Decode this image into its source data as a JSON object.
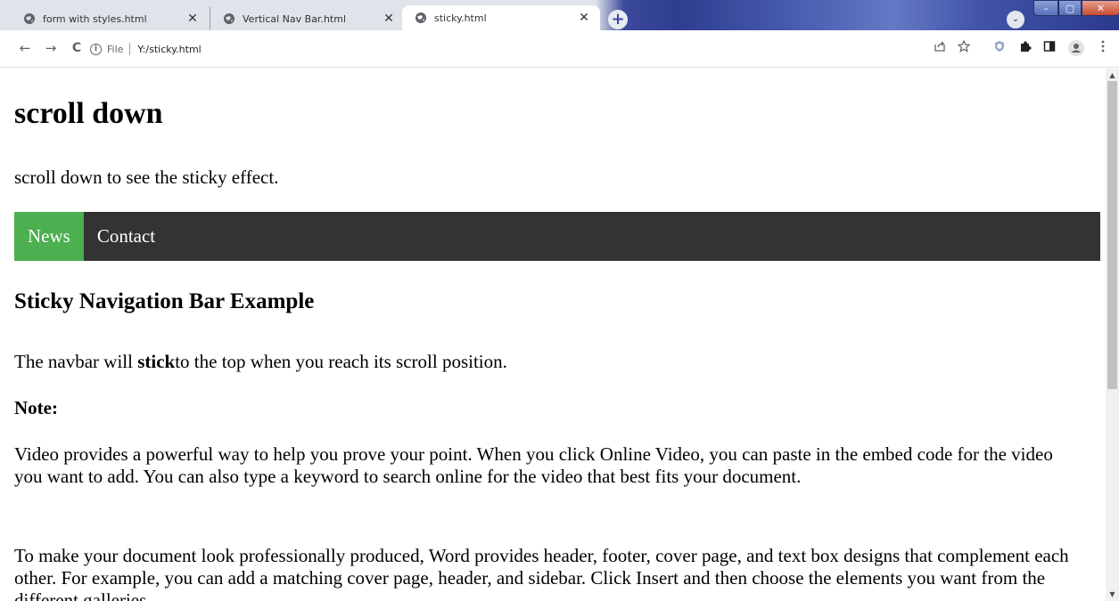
{
  "browser": {
    "tabs": [
      {
        "title": "form with styles.html",
        "active": false
      },
      {
        "title": "Vertical Nav Bar.html",
        "active": false
      },
      {
        "title": "sticky.html",
        "active": true
      }
    ],
    "close_glyph": "✕",
    "new_tab_glyph": "+",
    "tab_search_glyph": "⌄",
    "window_controls": {
      "minimize": "–",
      "maximize": "▢",
      "close": "✕"
    },
    "toolbar": {
      "back_glyph": "←",
      "forward_glyph": "→",
      "reload_glyph": "C",
      "site_info_glyph": "i",
      "scheme_label": "File",
      "address": "Y:/sticky.html",
      "icons": [
        "share-icon",
        "star-icon",
        "shield-extension-icon",
        "puzzle-extensions-icon",
        "side-panel-icon",
        "profile-icon",
        "kebab-menu-icon"
      ]
    }
  },
  "page": {
    "heading": "scroll down",
    "intro": "scroll down to see the sticky effect.",
    "navbar": {
      "links": [
        {
          "label": "News",
          "active": true
        },
        {
          "label": "Contact",
          "active": false
        }
      ],
      "background": "#333333",
      "active_color": "#4CAF50"
    },
    "subheading": "Sticky Navigation Bar Example",
    "sentence_before": "The navbar will ",
    "sentence_bold": "stick",
    "sentence_after": "to the top when you reach its scroll position.",
    "note_label": "Note:",
    "paragraph1": "Video provides a powerful way to help you prove your point. When you click Online Video, you can paste in the embed code for the video you want to add. You can also type a keyword to search online for the video that best fits your document.",
    "paragraph2": "To make your document look professionally produced, Word provides header, footer, cover page, and text box designs that complement each other. For example, you can add a matching cover page, header, and sidebar. Click Insert and then choose the elements you want from the different galleries."
  },
  "scrollbar": {
    "up_glyph": "▲",
    "down_glyph": "▼"
  }
}
